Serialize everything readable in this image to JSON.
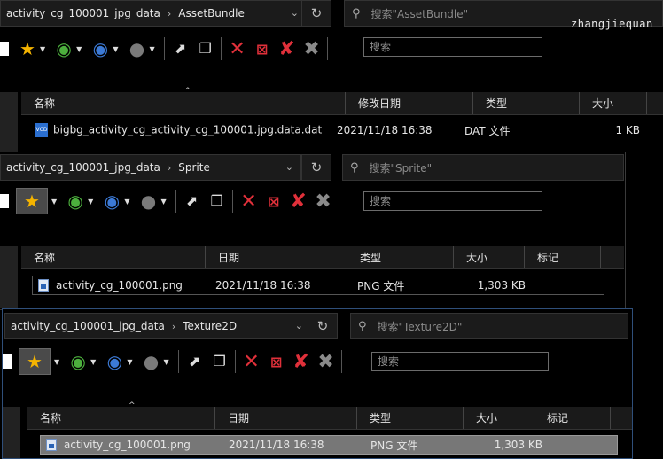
{
  "watermark": "zhangjiequan",
  "toolbar_search_placeholder": "搜索",
  "windows": [
    {
      "breadcrumb": [
        "activity_cg_100001_jpg_data",
        "AssetBundle"
      ],
      "search_placeholder": "搜索\"AssetBundle\"",
      "columns": [
        "名称",
        "修改日期",
        "类型",
        "大小"
      ],
      "rows": [
        {
          "name": "bigbg_activity_cg_activity_cg_100001.jpg.data.dat",
          "date": "2021/11/18 16:38",
          "type": "DAT 文件",
          "size": "1 KB"
        }
      ]
    },
    {
      "breadcrumb": [
        "activity_cg_100001_jpg_data",
        "Sprite"
      ],
      "search_placeholder": "搜索\"Sprite\"",
      "columns": [
        "名称",
        "日期",
        "类型",
        "大小",
        "标记"
      ],
      "rows": [
        {
          "name": "activity_cg_100001.png",
          "date": "2021/11/18 16:38",
          "type": "PNG 文件",
          "size": "1,303 KB",
          "tag": ""
        }
      ]
    },
    {
      "breadcrumb": [
        "activity_cg_100001_jpg_data",
        "Texture2D"
      ],
      "search_placeholder": "搜索\"Texture2D\"",
      "columns": [
        "名称",
        "日期",
        "类型",
        "大小",
        "标记"
      ],
      "rows": [
        {
          "name": "activity_cg_100001.png",
          "date": "2021/11/18 16:38",
          "type": "PNG 文件",
          "size": "1,303 KB",
          "tag": ""
        }
      ]
    }
  ]
}
